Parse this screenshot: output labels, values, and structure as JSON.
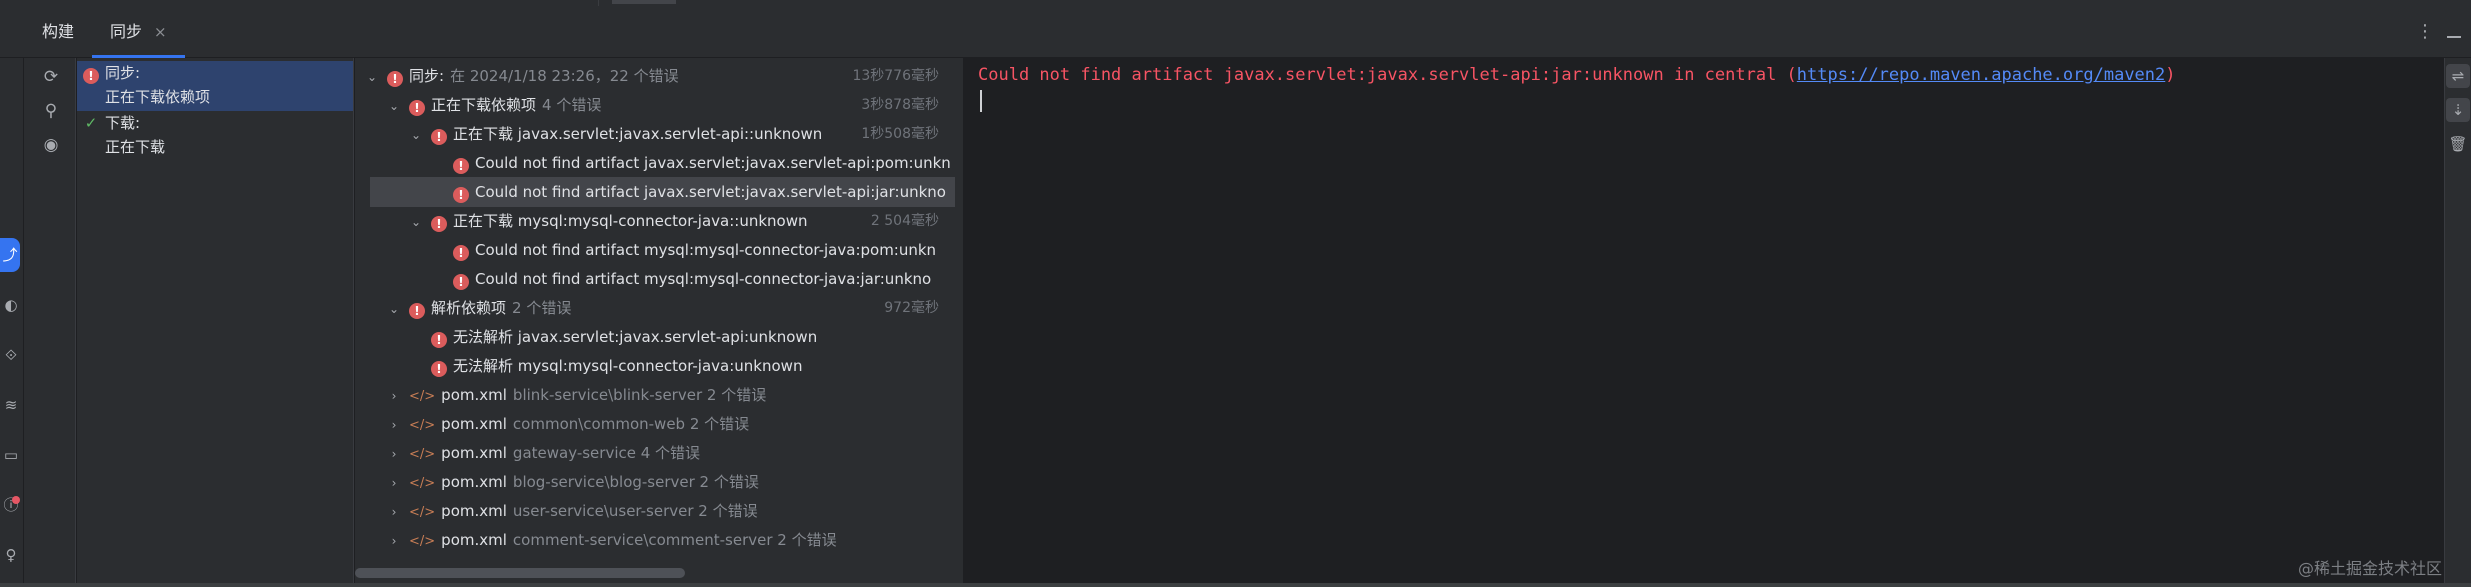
{
  "tabs": {
    "build": "构建",
    "sync": "同步",
    "sync_close": "×"
  },
  "summary": [
    {
      "status": "error",
      "label": "同步:",
      "sub": "正在下载依赖项"
    },
    {
      "status": "success",
      "label": "下载:",
      "sub": "正在下载"
    }
  ],
  "tree": [
    {
      "indent": 0,
      "expand": "open",
      "status": "error",
      "title": "同步:",
      "detail": "在 2024/1/18 23:26，22 个错误",
      "time": "13秒776毫秒"
    },
    {
      "indent": 1,
      "expand": "open",
      "status": "error",
      "title": "正在下载依赖项",
      "detail": "4 个错误",
      "time": "3秒878毫秒"
    },
    {
      "indent": 2,
      "expand": "open",
      "status": "error",
      "title": "正在下载 javax.servlet:javax.servlet-api::unknown",
      "detail": "",
      "time": "1秒508毫秒"
    },
    {
      "indent": 3,
      "expand": "none",
      "status": "error",
      "title": "Could not find artifact javax.servlet:javax.servlet-api:pom:unkn",
      "detail": "",
      "time": ""
    },
    {
      "indent": 3,
      "expand": "none",
      "status": "error",
      "title": "Could not find artifact javax.servlet:javax.servlet-api:jar:unkno",
      "detail": "",
      "time": "",
      "selected": true
    },
    {
      "indent": 2,
      "expand": "open",
      "status": "error",
      "title": "正在下载 mysql:mysql-connector-java::unknown",
      "detail": "",
      "time": "2 504毫秒"
    },
    {
      "indent": 3,
      "expand": "none",
      "status": "error",
      "title": "Could not find artifact mysql:mysql-connector-java:pom:unkn",
      "detail": "",
      "time": ""
    },
    {
      "indent": 3,
      "expand": "none",
      "status": "error",
      "title": "Could not find artifact mysql:mysql-connector-java:jar:unkno",
      "detail": "",
      "time": ""
    },
    {
      "indent": 1,
      "expand": "open",
      "status": "error",
      "title": "解析依赖项",
      "detail": "2 个错误",
      "time": "972毫秒"
    },
    {
      "indent": 2,
      "expand": "none",
      "status": "error",
      "title": "无法解析 javax.servlet:javax.servlet-api:unknown",
      "detail": "",
      "time": ""
    },
    {
      "indent": 2,
      "expand": "none",
      "status": "error",
      "title": "无法解析 mysql:mysql-connector-java:unknown",
      "detail": "",
      "time": ""
    },
    {
      "indent": 1,
      "expand": "closed",
      "status": "xml",
      "title": "pom.xml",
      "detail": "blink-service\\blink-server 2 个错误",
      "time": ""
    },
    {
      "indent": 1,
      "expand": "closed",
      "status": "xml",
      "title": "pom.xml",
      "detail": "common\\common-web 2 个错误",
      "time": ""
    },
    {
      "indent": 1,
      "expand": "closed",
      "status": "xml",
      "title": "pom.xml",
      "detail": "gateway-service 4 个错误",
      "time": ""
    },
    {
      "indent": 1,
      "expand": "closed",
      "status": "xml",
      "title": "pom.xml",
      "detail": "blog-service\\blog-server 2 个错误",
      "time": ""
    },
    {
      "indent": 1,
      "expand": "closed",
      "status": "xml",
      "title": "pom.xml",
      "detail": "user-service\\user-server 2 个错误",
      "time": ""
    },
    {
      "indent": 1,
      "expand": "closed",
      "status": "xml",
      "title": "pom.xml",
      "detail": "comment-service\\comment-server 2 个错误",
      "time": ""
    }
  ],
  "console": {
    "message_prefix": "Could not find artifact javax.servlet:javax.servlet-api:jar:unknown in central (",
    "link": "https://repo.maven.apache.org/maven2",
    "message_suffix": ")"
  },
  "watermark": "@稀土掘金技术社区",
  "icons": {
    "tool_sync": "sync-icon",
    "tool_pin": "pin-icon",
    "tool_eye": "eye-icon",
    "console_wrap": "soft-wrap-icon",
    "console_scroll": "scroll-to-end-icon",
    "console_clear": "trash-icon"
  },
  "colors": {
    "accent": "#3574f0",
    "error": "#db5c5c",
    "success": "#5fb865",
    "link": "#548af7",
    "console_error": "#f75464"
  }
}
